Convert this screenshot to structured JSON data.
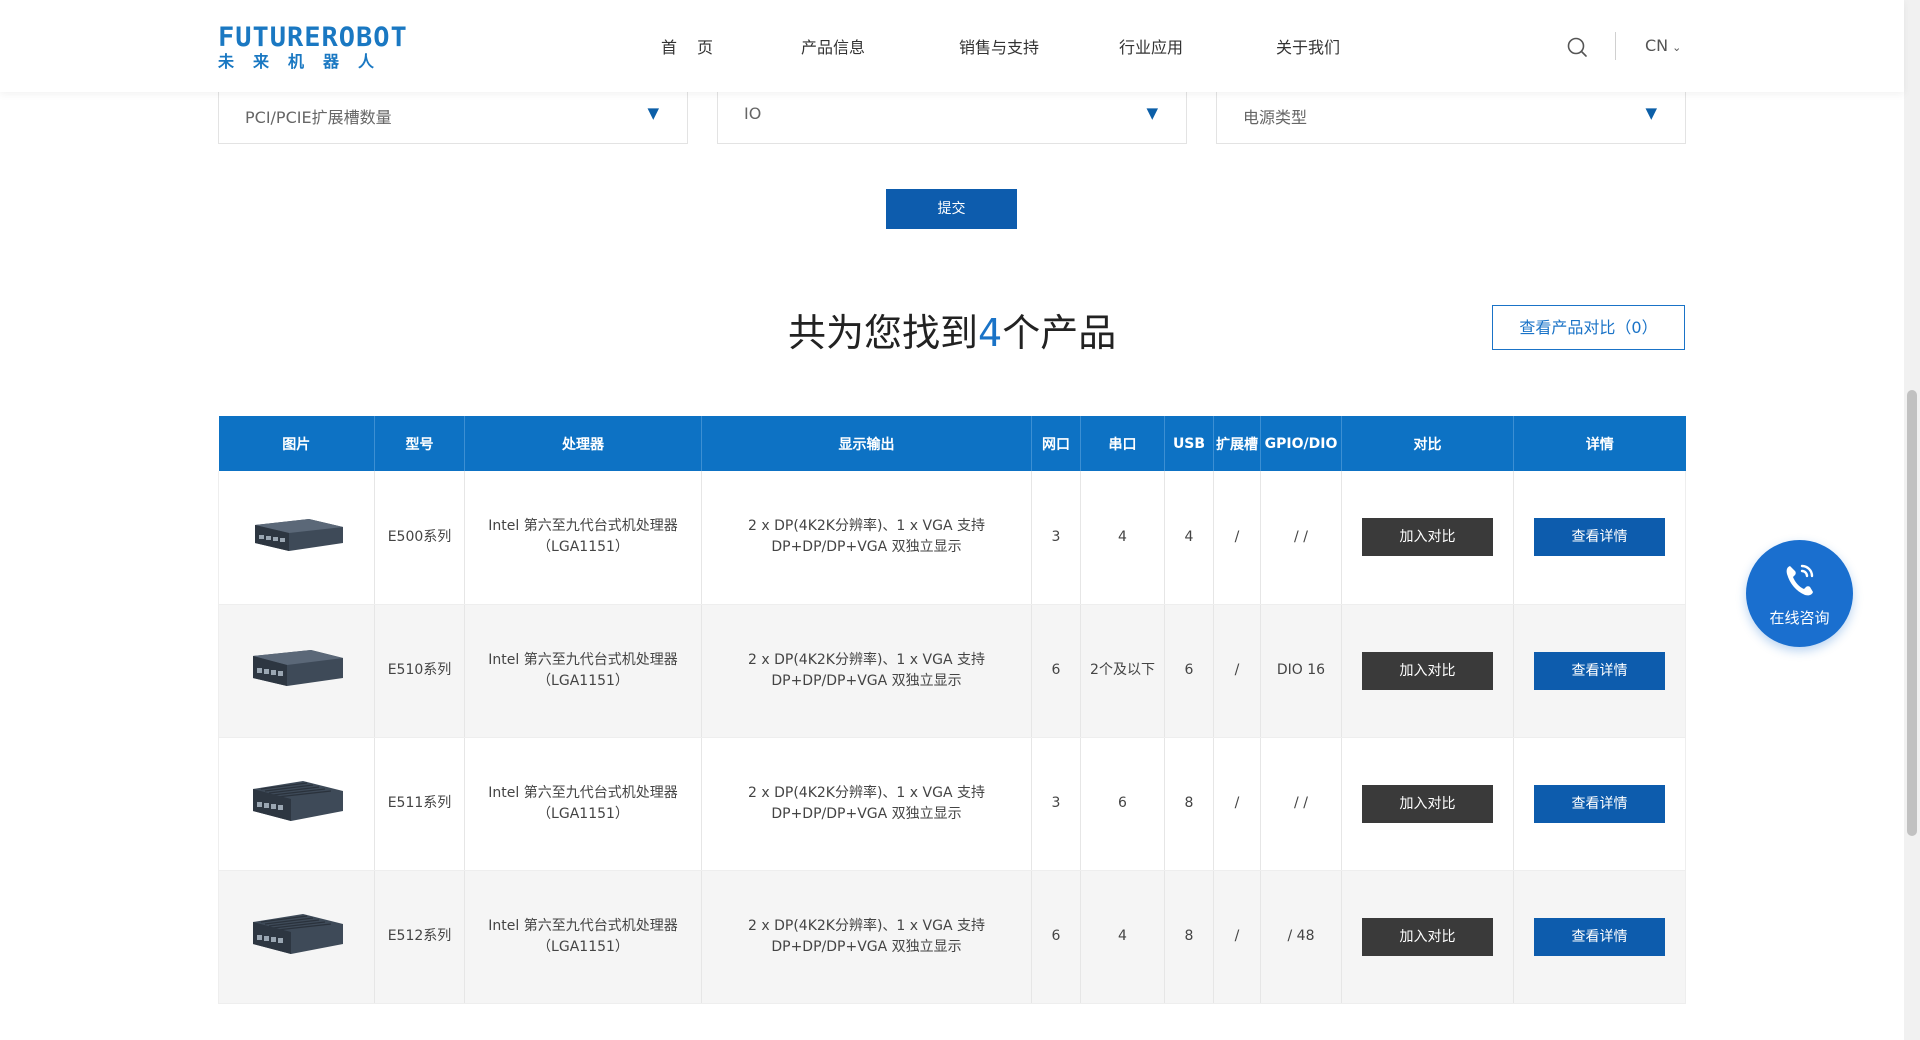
{
  "header": {
    "logo_en": "FUTUREROBOT",
    "logo_cn": "未来机器人",
    "nav": [
      "首页",
      "产品信息",
      "销售与支持",
      "行业应用",
      "关于我们"
    ],
    "lang": "CN"
  },
  "filters": [
    {
      "label": "PCI/PCIE扩展槽数量"
    },
    {
      "label": "IO"
    },
    {
      "label": "电源类型"
    }
  ],
  "submit_label": "提交",
  "result": {
    "prefix": "共为您找到",
    "count": "4",
    "suffix": "个产品",
    "compare_button": "查看产品对比（0）"
  },
  "table": {
    "headers": [
      "图片",
      "型号",
      "处理器",
      "显示输出",
      "网口",
      "串口",
      "USB",
      "扩展槽",
      "GPIO/DIO",
      "对比",
      "详情"
    ],
    "rows": [
      {
        "model": "E500系列",
        "cpu": "Intel 第六至九代台式机处理器（LGA1151）",
        "display": "2 x DP(4K2K分辨率)、1 x VGA 支持DP+DP/DP+VGA 双独立显示",
        "lan": "3",
        "com": "4",
        "usb": "4",
        "slot": "/",
        "gpio": "/ /",
        "compare": "加入对比",
        "detail": "查看详情"
      },
      {
        "model": "E510系列",
        "cpu": "Intel 第六至九代台式机处理器（LGA1151）",
        "display": "2 x DP(4K2K分辨率)、1 x VGA 支持DP+DP/DP+VGA 双独立显示",
        "lan": "6",
        "com": "2个及以下",
        "usb": "6",
        "slot": "/",
        "gpio": "DIO 16",
        "compare": "加入对比",
        "detail": "查看详情"
      },
      {
        "model": "E511系列",
        "cpu": "Intel 第六至九代台式机处理器（LGA1151）",
        "display": "2 x DP(4K2K分辨率)、1 x VGA 支持DP+DP/DP+VGA 双独立显示",
        "lan": "3",
        "com": "6",
        "usb": "8",
        "slot": "/",
        "gpio": "/ /",
        "compare": "加入对比",
        "detail": "查看详情"
      },
      {
        "model": "E512系列",
        "cpu": "Intel 第六至九代台式机处理器（LGA1151）",
        "display": "2 x DP(4K2K分辨率)、1 x VGA 支持DP+DP/DP+VGA 双独立显示",
        "lan": "6",
        "com": "4",
        "usb": "8",
        "slot": "/",
        "gpio": "/ 48",
        "compare": "加入对比",
        "detail": "查看详情"
      }
    ]
  },
  "consult_label": "在线咨询",
  "colors": {
    "primary": "#0d72c4",
    "button_dark": "#3a3a3a",
    "accent": "#1a73c7"
  }
}
